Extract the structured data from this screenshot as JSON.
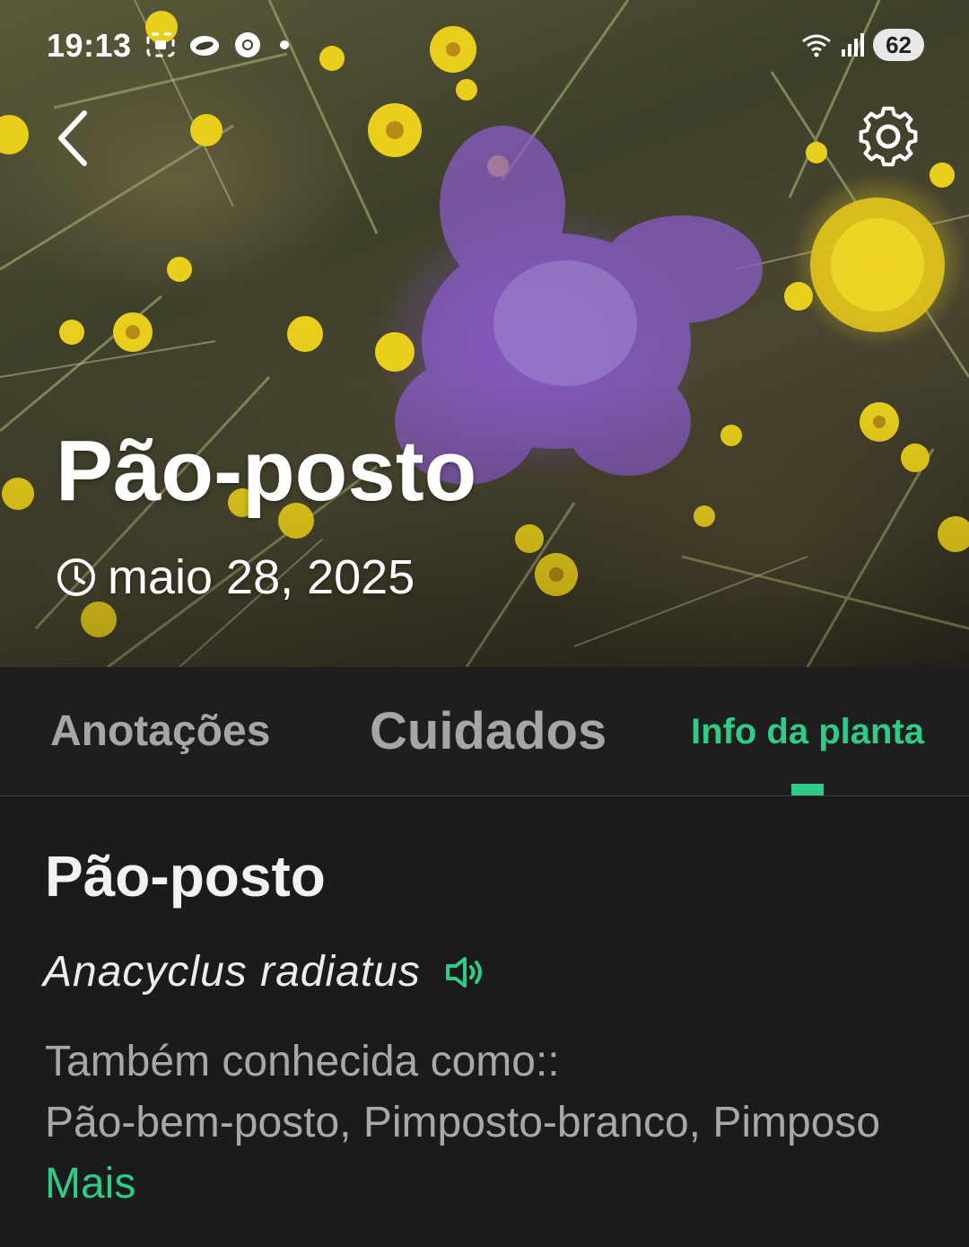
{
  "status_bar": {
    "time": "19:13",
    "battery": "62",
    "icons": [
      "screenshot-icon",
      "cloud-icon",
      "chrome-icon",
      "notification-dot",
      "wifi-icon",
      "signal-icon"
    ]
  },
  "hero": {
    "title": "Pão-posto",
    "date": "maio 28, 2025"
  },
  "tabs": [
    {
      "label": "Anotações",
      "active": false
    },
    {
      "label": "Cuidados",
      "active": false
    },
    {
      "label": "Info da planta",
      "active": true
    }
  ],
  "plant_info": {
    "common_name": "Pão-posto",
    "scientific_name": "Anacyclus radiatus",
    "also_known_label": "Também conhecida como::",
    "also_known_names": "Pão-bem-posto, Pimposto-branco, Pimposo",
    "more_label": "Mais"
  },
  "colors": {
    "accent": "#2ecc87",
    "background": "#1b1b1b",
    "tab_inactive": "#a6a6a6",
    "secondary_text": "#a8a8a8"
  }
}
